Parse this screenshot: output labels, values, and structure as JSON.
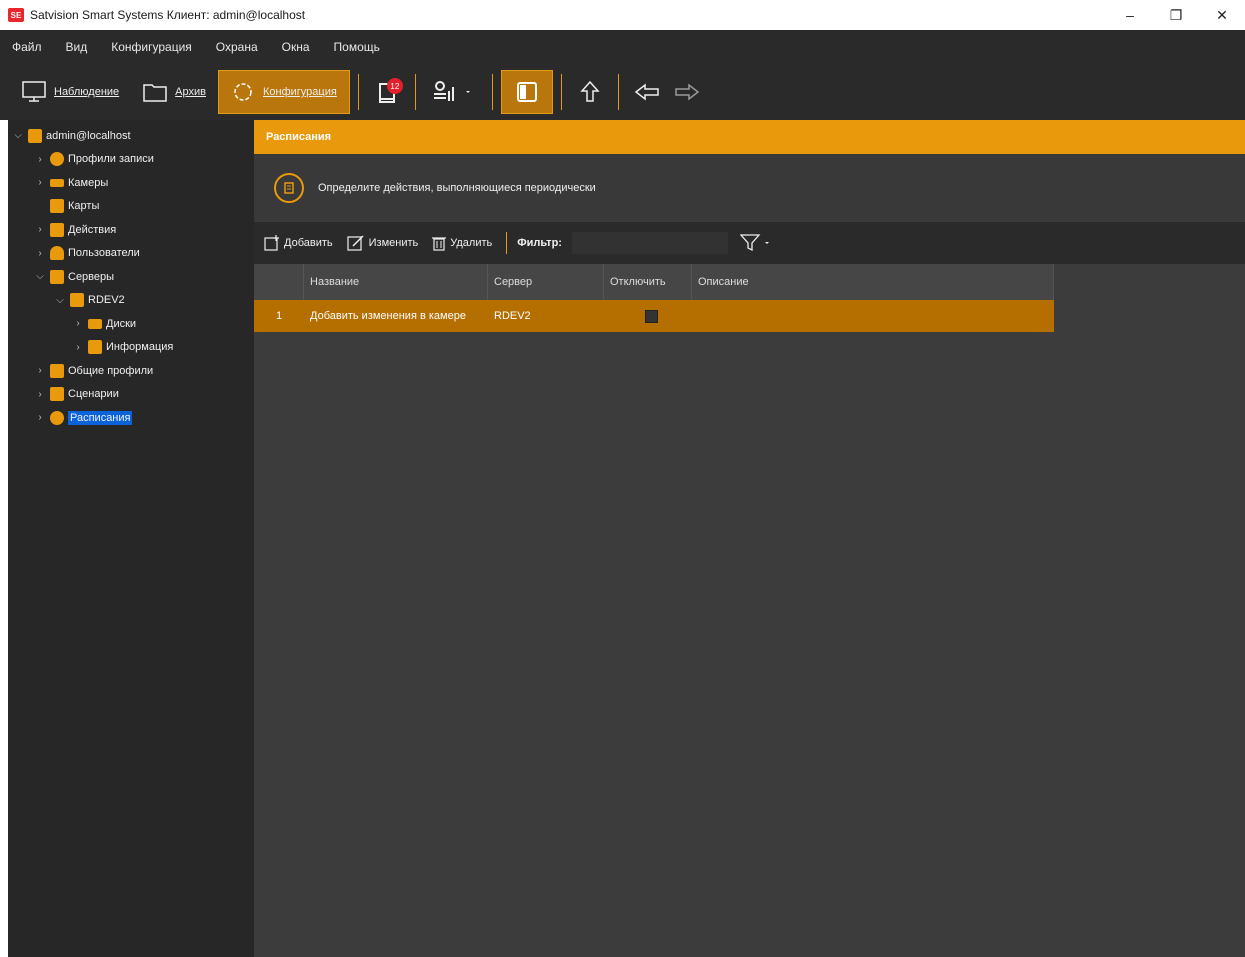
{
  "window": {
    "title": "Satvision Smart Systems Клиент: admin@localhost",
    "icon_text": "SE",
    "controls": {
      "minimize": "–",
      "restore": "❐",
      "close": "✕"
    }
  },
  "menu": [
    {
      "label": "Файл"
    },
    {
      "label": "Вид"
    },
    {
      "label": "Конфигурация"
    },
    {
      "label": "Охрана"
    },
    {
      "label": "Окна"
    },
    {
      "label": "Помощь"
    }
  ],
  "toolbar": {
    "monitoring": "Наблюдение",
    "archive": "Архив",
    "configuration": "Конфигурация",
    "events_badge": "12"
  },
  "tree": {
    "root": "admin@localhost",
    "items": [
      {
        "label": "Профили записи"
      },
      {
        "label": "Камеры"
      },
      {
        "label": "Карты"
      },
      {
        "label": "Действия"
      },
      {
        "label": "Пользователи"
      },
      {
        "label": "Серверы"
      },
      {
        "label": "RDEV2"
      },
      {
        "label": "Диски"
      },
      {
        "label": "Информация"
      },
      {
        "label": "Общие профили"
      },
      {
        "label": "Сценарии"
      },
      {
        "label": "Расписания"
      }
    ]
  },
  "pane": {
    "header": "Расписания",
    "description": "Определите действия, выполняющиеся периодически",
    "actions": {
      "add": "Добавить",
      "edit": "Изменить",
      "delete": "Удалить",
      "filter_label": "Фильтр:",
      "filter_value": ""
    },
    "table": {
      "columns": [
        "Название",
        "Сервер",
        "Отключить",
        "Описание"
      ],
      "rows": [
        {
          "num": "1",
          "name": "Добавить изменения в камере",
          "server": "RDEV2",
          "disabled": false,
          "description": ""
        }
      ]
    }
  },
  "colors": {
    "accent": "#e99a0c",
    "selected_row": "#b56f00",
    "tree_selection": "#0a63d8",
    "background": "#3c3c3c"
  }
}
